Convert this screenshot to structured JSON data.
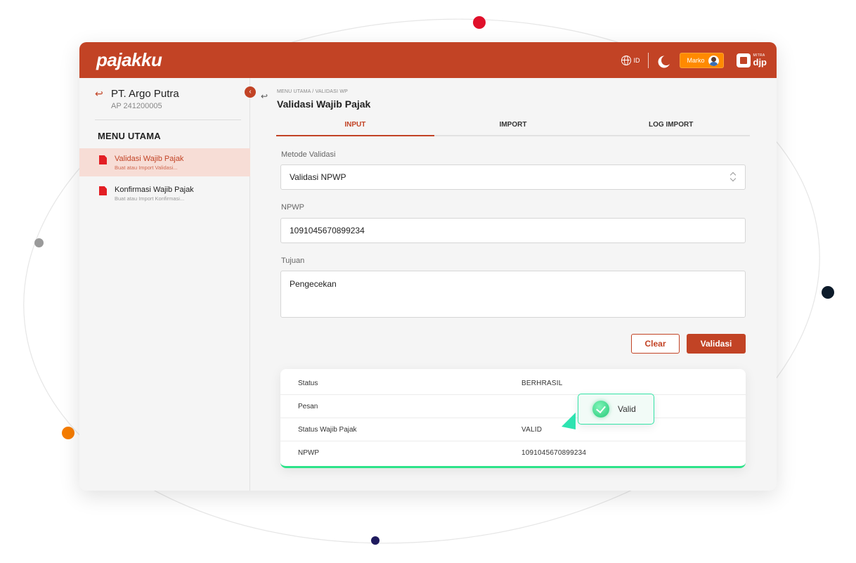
{
  "brand": {
    "logo_text": "pajakku",
    "accent": "#c24325"
  },
  "topbar": {
    "language": "ID",
    "user_name": "Marko",
    "mitra_small": "MITRA",
    "mitra_big": "djp",
    "icons": [
      "globe-icon",
      "moon-icon",
      "avatar",
      "mitra-djp-logo"
    ]
  },
  "sidebar": {
    "company_name": "PT. Argo Putra",
    "company_id": "AP 241200005",
    "menu_heading": "MENU UTAMA",
    "items": [
      {
        "title": "Validasi Wajib Pajak",
        "subtitle": "Buat atau Import Validasi...",
        "active": true
      },
      {
        "title": "Konfirmasi Wajib Pajak",
        "subtitle": "Buat atau Import Konfirmasi...",
        "active": false
      }
    ]
  },
  "main": {
    "breadcrumb": "MENU UTAMA / VALIDASI WP",
    "title": "Validasi Wajib Pajak",
    "tabs": [
      {
        "label": "INPUT",
        "active": true
      },
      {
        "label": "IMPORT",
        "active": false
      },
      {
        "label": "LOG IMPORT",
        "active": false
      }
    ],
    "form": {
      "metode_label": "Metode Validasi",
      "metode_value": "Validasi NPWP",
      "npwp_label": "NPWP",
      "npwp_value": "1091045670899234",
      "tujuan_label": "Tujuan",
      "tujuan_value": "Pengecekan"
    },
    "buttons": {
      "clear": "Clear",
      "validasi": "Validasi"
    },
    "result": {
      "rows": [
        {
          "key": "Status",
          "value": "BERHRASIL"
        },
        {
          "key": "Pesan",
          "value": ""
        },
        {
          "key": "Status Wajib Pajak",
          "value": "VALID"
        },
        {
          "key": "NPWP",
          "value": "1091045670899234"
        }
      ]
    },
    "badge": {
      "label": "Valid"
    }
  },
  "colors": {
    "header": "#c24325",
    "user_pill": "#ff8a00",
    "valid_green": "#2de38a",
    "dot_red": "#e0102a",
    "dot_orange": "#f57c00",
    "dot_navy": "#0d1b2a",
    "dot_indigo": "#1f1a5e",
    "dot_gray": "#9a9a9a"
  }
}
